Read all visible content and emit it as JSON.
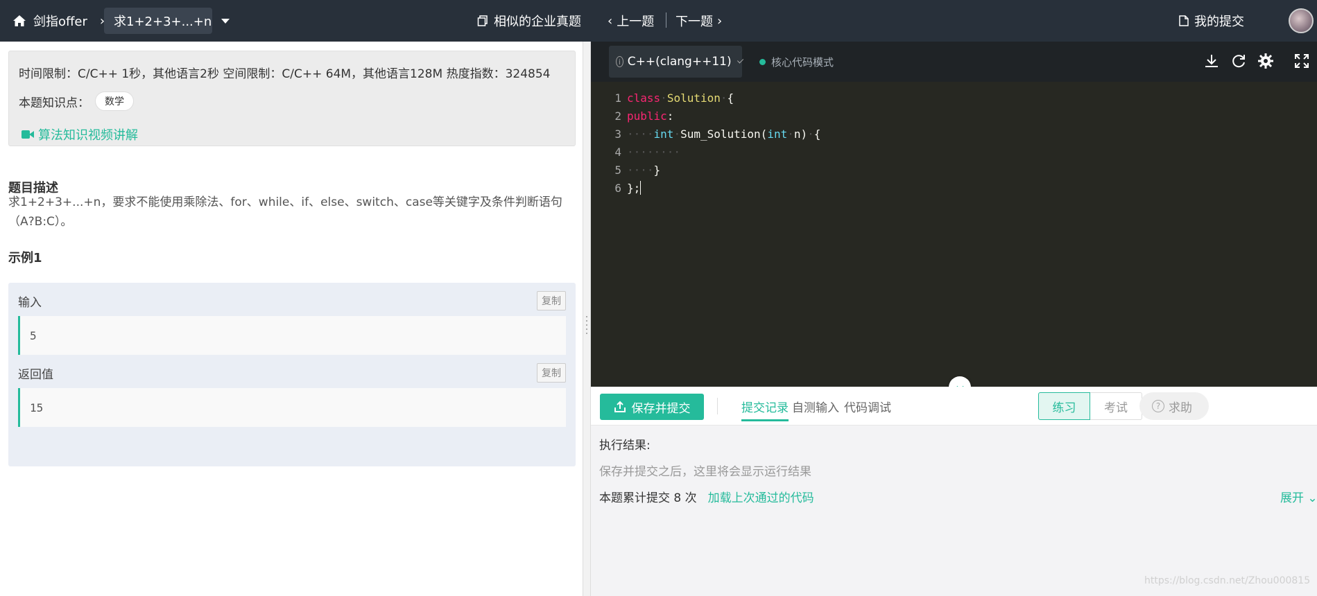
{
  "header": {
    "home_label": "剑指offer",
    "topic": "求1+2+3+...+n",
    "similar_label": "相似的企业真题",
    "prev_label": "上一题",
    "next_label": "下一题",
    "my_submissions_label": "我的提交"
  },
  "problem": {
    "limits_text": "时间限制：C/C++ 1秒，其他语言2秒    空间限制：C/C++ 64M，其他语言128M    热度指数：324854",
    "knowledge_label": "本题知识点：",
    "knowledge_tag": "数学",
    "video_link": "算法知识视频讲解",
    "desc_title": "题目描述",
    "description": "求1+2+3+...+n，要求不能使用乘除法、for、while、if、else、switch、case等关键字及条件判断语句（A?B:C）。",
    "example_title": "示例1",
    "example": {
      "input_label": "输入",
      "input_value": "5",
      "output_label": "返回值",
      "output_value": "15",
      "copy_label": "复制"
    }
  },
  "editor": {
    "language": "C++(clang++11)",
    "mode": "核心代码模式",
    "tools": [
      "download-icon",
      "reset-icon",
      "settings-icon",
      "fullscreen-icon"
    ],
    "line_numbers": [
      "1",
      "2",
      "3",
      "4",
      "5",
      "6"
    ],
    "code": {
      "l1_kw": "class",
      "l1_name": "Solution",
      "l1_rest": "{",
      "l2_kw": "public",
      "l2_rest": ":",
      "l3_type": "int",
      "l3_fn": "Sum_Solution(",
      "l3_type2": "int",
      "l3_rest": "n)",
      "l3_brace": "{",
      "l5_rest": "}",
      "l6_rest": "};"
    }
  },
  "bottom": {
    "submit_label": "保存并提交",
    "tabs": [
      "提交记录",
      "自测输入",
      "代码调试"
    ],
    "practice_label": "练习",
    "exam_label": "考试",
    "help_label": "求助",
    "result_label": "执行结果:",
    "result_hint": "保存并提交之后，这里将会显示运行结果",
    "submission_count": "本题累计提交 8 次",
    "load_last_label": "加载上次通过的代码",
    "expand_label": "展开"
  },
  "watermark": "https://blog.csdn.net/Zhou000815",
  "colors": {
    "accent": "#25bb9b",
    "topbar": "#28303a",
    "editor_bg": "#272822"
  }
}
